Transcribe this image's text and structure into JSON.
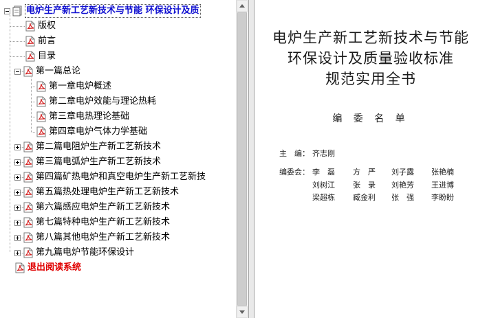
{
  "bookmarks": {
    "root": "电炉生产新工艺新技术与节能 环保设计及质",
    "copyright": "版权",
    "preface": "前言",
    "contents": "目录",
    "part1": "第一篇总论",
    "ch1": "第一章电炉概述",
    "ch2": "第二章电炉效能与理论热耗",
    "ch3": "第三章电热理论基础",
    "ch4": "第四章电炉气体力学基础",
    "part2": "第二篇电阻炉生产新工艺新技术",
    "part3": "第三篇电弧炉生产新工艺新技术",
    "part4": "第四篇矿热电炉和真空电炉生产新工艺新技",
    "part5": "第五篇热处理电炉生产新工艺新技术",
    "part6": "第六篇感应电炉生产新工艺新技术",
    "part7": "第七篇特种电炉生产新工艺新技术",
    "part8": "第八篇其他电炉生产新工艺新技术",
    "part9": "第九篇电炉节能环保设计",
    "exit": "退出阅读系统"
  },
  "page": {
    "title_line1": "电炉生产新工艺新技术与节能",
    "title_line2": "环保设计及质量验收标准",
    "title_line3": "规范实用全书",
    "committee_heading": "编 委 名 单",
    "editor_label": "主　编：",
    "editor_name": "齐志刚",
    "committee_label": "编委会：",
    "members": [
      "李　磊",
      "方　严",
      "刘子露",
      "张艳楠",
      "刘树江",
      "张　录",
      "刘艳芳",
      "王进博",
      "梁超栋",
      "臧金利",
      "张　强",
      "李盼盼"
    ]
  },
  "colors": {
    "root_text": "#1010d0",
    "exit_text": "#e00000",
    "pdf_icon_red": "#d42020"
  },
  "icons": {
    "root": "book-page-icon",
    "item": "pdf-page-icon",
    "expand": "plus-box-icon",
    "collapse": "minus-box-icon"
  }
}
